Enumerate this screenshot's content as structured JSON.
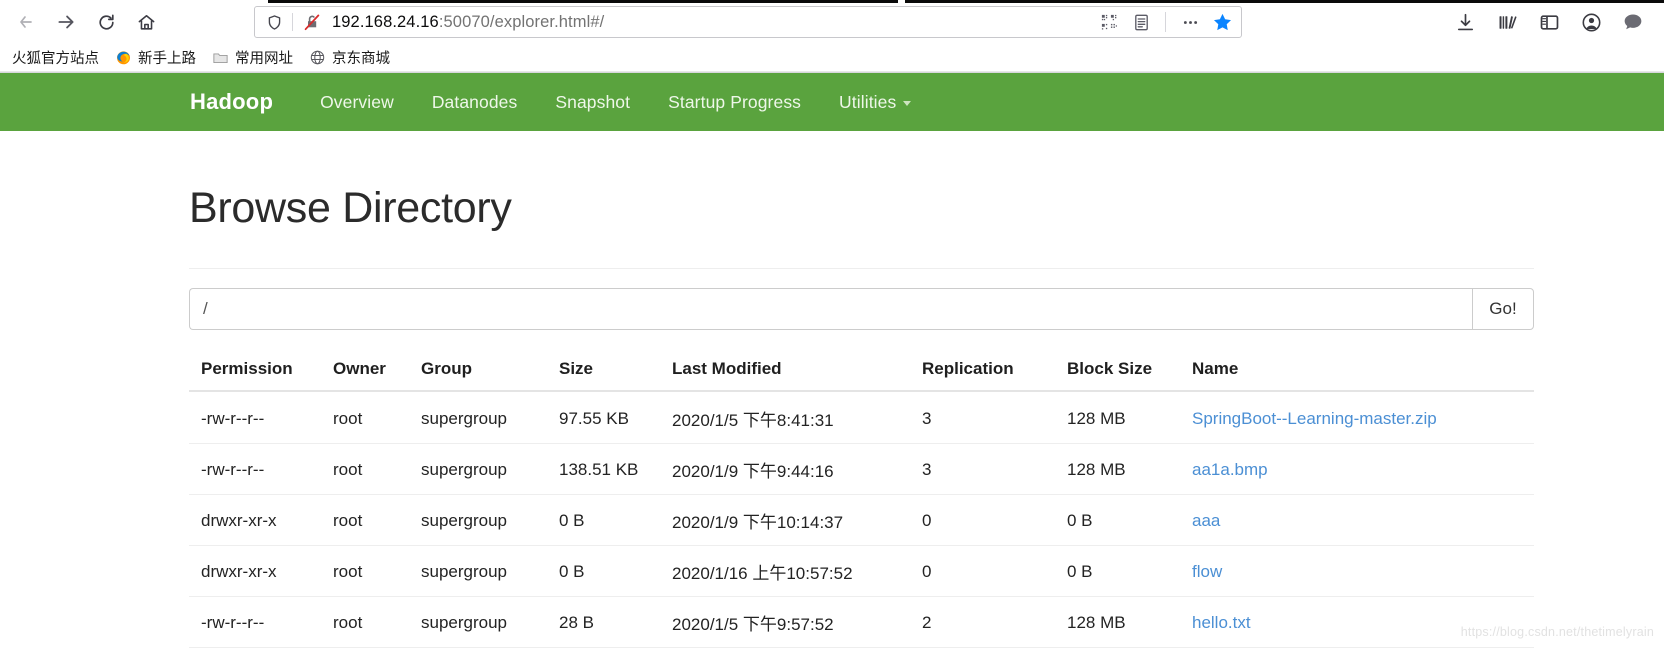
{
  "browser": {
    "nav_buttons": [
      {
        "name": "back-button",
        "icon": "arrow-left-icon",
        "label": "Back"
      },
      {
        "name": "forward-button",
        "icon": "arrow-right-icon",
        "label": "Forward"
      },
      {
        "name": "reload-button",
        "icon": "reload-icon",
        "label": "Reload"
      },
      {
        "name": "home-button",
        "icon": "home-icon",
        "label": "Home"
      }
    ],
    "url": {
      "host": "192.168.24.16",
      "path": ":50070/explorer.html#/",
      "full": "192.168.24.16:50070/explorer.html#/"
    },
    "urlbar_icons": [
      {
        "name": "shield-icon",
        "label": "Tracking protection"
      },
      {
        "name": "broken-lock-icon",
        "label": "Connection is not secure"
      },
      {
        "name": "qr-code-icon",
        "label": "QR code"
      },
      {
        "name": "reader-view-icon",
        "label": "Reader view"
      },
      {
        "name": "page-actions-icon",
        "label": "Page actions"
      },
      {
        "name": "bookmark-star-icon",
        "label": "Bookmark this page"
      }
    ],
    "toolbar_right_icons": [
      {
        "name": "downloads-icon",
        "label": "Downloads"
      },
      {
        "name": "library-icon",
        "label": "Library"
      },
      {
        "name": "sidebar-icon",
        "label": "Sidebars"
      },
      {
        "name": "account-icon",
        "label": "Account"
      },
      {
        "name": "chat-icon",
        "label": "Messages"
      }
    ],
    "bookmarks": [
      {
        "label": "火狐官方站点",
        "icon": "no-icon"
      },
      {
        "label": "新手上路",
        "icon": "firefox-icon"
      },
      {
        "label": "常用网址",
        "icon": "folder-icon"
      },
      {
        "label": "京东商城",
        "icon": "globe-icon"
      }
    ]
  },
  "hadoop": {
    "brand": "Hadoop",
    "nav_color": "#5aa33e",
    "nav_items": [
      {
        "label": "Overview",
        "caret": false
      },
      {
        "label": "Datanodes",
        "caret": false
      },
      {
        "label": "Snapshot",
        "caret": false
      },
      {
        "label": "Startup Progress",
        "caret": false
      },
      {
        "label": "Utilities",
        "caret": true
      }
    ]
  },
  "main": {
    "title": "Browse Directory",
    "path_value": "/",
    "path_placeholder": "",
    "go_label": "Go!",
    "columns": [
      "Permission",
      "Owner",
      "Group",
      "Size",
      "Last Modified",
      "Replication",
      "Block Size",
      "Name"
    ],
    "rows": [
      {
        "permission": "-rw-r--r--",
        "owner": "root",
        "group": "supergroup",
        "size": "97.55 KB",
        "modified": "2020/1/5 下午8:41:31",
        "replication": "3",
        "block_size": "128 MB",
        "name": "SpringBoot--Learning-master.zip"
      },
      {
        "permission": "-rw-r--r--",
        "owner": "root",
        "group": "supergroup",
        "size": "138.51 KB",
        "modified": "2020/1/9 下午9:44:16",
        "replication": "3",
        "block_size": "128 MB",
        "name": "aa1a.bmp"
      },
      {
        "permission": "drwxr-xr-x",
        "owner": "root",
        "group": "supergroup",
        "size": "0 B",
        "modified": "2020/1/9 下午10:14:37",
        "replication": "0",
        "block_size": "0 B",
        "name": "aaa"
      },
      {
        "permission": "drwxr-xr-x",
        "owner": "root",
        "group": "supergroup",
        "size": "0 B",
        "modified": "2020/1/16 上午10:57:52",
        "replication": "0",
        "block_size": "0 B",
        "name": "flow"
      },
      {
        "permission": "-rw-r--r--",
        "owner": "root",
        "group": "supergroup",
        "size": "28 B",
        "modified": "2020/1/5 下午9:57:52",
        "replication": "2",
        "block_size": "128 MB",
        "name": "hello.txt"
      }
    ],
    "watermark": "https://blog.csdn.net/thetimelyrain"
  },
  "colors": {
    "nav_green": "#5aa33e",
    "link_blue": "#4b8fd4",
    "star_blue": "#0a84ff"
  }
}
